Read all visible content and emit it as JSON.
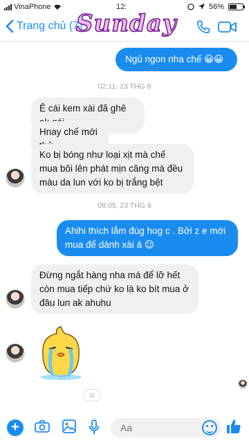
{
  "status_bar": {
    "carrier": "VinaPhone",
    "time": "12:",
    "battery": "56%",
    "battery_level": 0.56
  },
  "nav": {
    "back_label": "Trang chủ (7)",
    "sticker_text": "Sunday"
  },
  "messages": [
    {
      "side": "out",
      "text": "Ngủ ngon nha chế 😀😀"
    },
    {
      "type": "timestamp",
      "text": "02:11, 23 THG 8"
    },
    {
      "side": "in",
      "text": "Ê cái kem xài đã ghê ak gái"
    },
    {
      "side": "in",
      "text": "Hnay chế mới thử"
    },
    {
      "side": "in",
      "text": "Ko bị bóng như loại xịt mà chế mua bôi lên phát mịn căng mà đều màu da lun với ko bị trắng bệt"
    },
    {
      "type": "timestamp",
      "text": "08:05, 23 THG 8"
    },
    {
      "side": "out",
      "text": "Ahihi thích lắm đúg hog c . Bởi z e mới mua để dành xài á 😉"
    },
    {
      "side": "in",
      "text": "Đừng ngắt hàng nha má để lỡ hết còn mua tiếp chứ ko là ko bít mua ở đâu lun ak ahuhu"
    }
  ],
  "composer": {
    "placeholder": "Aa"
  },
  "colors": {
    "accent": "#1a8cf0",
    "incoming_bubble": "#f1f0f0"
  }
}
